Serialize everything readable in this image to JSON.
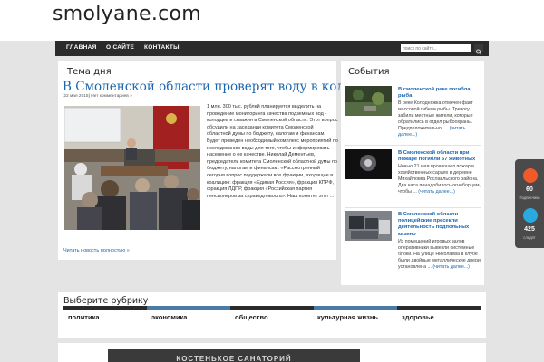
{
  "site": {
    "logo": "smolyane.com"
  },
  "nav": {
    "items": [
      "ГЛАВНАЯ",
      "О САЙТЕ",
      "КОНТАКТЫ"
    ]
  },
  "search": {
    "placeholder": "поиск по сайту..."
  },
  "featured": {
    "section_title": "Тема дня",
    "headline": "В Смоленской области проверят воду в колодцах",
    "meta": "[22 мая 2015] Нет комментариев »",
    "excerpt": "1 млн. 300 тыс. рублей планируется выделить на проведение мониторинга качества подземных вод - колодцев и скважин в Смоленской области. Этот вопрос обсудили на заседании комитета Смоленской областной думы по бюджету, налогам и финансам. Будет проведен необходимый комплекс мероприятий по исследованию воды для того, чтобы информировать население о ее качестве. Николай Дементьев, председатель комитета Смоленской областной думы по бюджету, налогам и финансам: «Рассмотренный сегодня вопрос поддержали все фракции, входящие в коалицию: фракция «Единая Россия», фракция КПРФ, фракция ЛДПР, фракция «Российская партия пенсионеров за справедливость». Наш комитет этот ...",
    "read_more": "Читать новость полностью »"
  },
  "events": {
    "section_title": "События",
    "items": [
      {
        "title": "В смоленской реке погибла рыба",
        "text": "В реке Колодняжка отмечен факт массовой гибели рыбы. Тревогу забили местные жители, которые обратились в отдел рыбоохраны. Предположительно, ...",
        "more": "(читать далее...)"
      },
      {
        "title": "В Смоленской области при пожаре погибли 67 животных",
        "text": "Ночью 21 мая произошел пожар в хозяйственных сараях в деревне Михайловка Рославльского района. Два часа понадобилось огнеборцам, чтобы ...",
        "more": "(читать далее...)"
      },
      {
        "title": "В Смоленской области полицейские пресекли деятельность подпольных казино",
        "text": "Из помещений игровых залов оперативники вывезли системные блоки. На улице Николаева в клубе были двойные металлические двери, установлена ...",
        "more": "(читать далее...)"
      }
    ]
  },
  "rubrics": {
    "title": "Выберите рубрику",
    "items": [
      "политика",
      "экономика",
      "общество",
      "культурная жизнь",
      "здоровье"
    ]
  },
  "banner": {
    "text": "КОСТЕНЬКОЕ САНАТОРИЙ"
  },
  "social": [
    {
      "count": "60",
      "label": "Подписчики",
      "color": "#f05a28"
    },
    {
      "count": "425",
      "label": "следят",
      "color": "#2aa9e0"
    }
  ],
  "colors": {
    "accent": "#1a66b0",
    "nav_bg": "#2b2b2b",
    "rubric_active": "#4a7aa6"
  }
}
